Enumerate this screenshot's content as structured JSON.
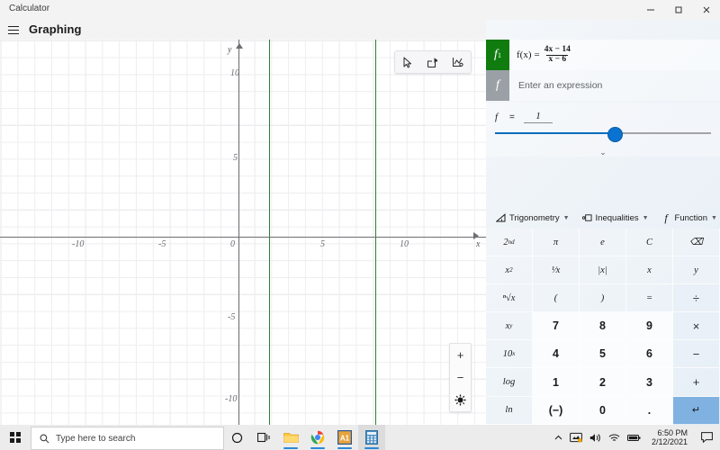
{
  "window": {
    "app_title": "Calculator",
    "minimize_icon": "minimize-icon",
    "maximize_icon": "maximize-icon",
    "close_icon": "close-icon"
  },
  "header": {
    "menu_icon": "hamburger-menu-icon",
    "mode_title": "Graphing"
  },
  "graph": {
    "x_axis_label": "x",
    "y_axis_label": "y",
    "x_ticks": [
      {
        "label": "-10",
        "value": -10
      },
      {
        "label": "-5",
        "value": -5
      },
      {
        "label": "0",
        "value": 0
      },
      {
        "label": "5",
        "value": 5
      },
      {
        "label": "10",
        "value": 10
      }
    ],
    "y_ticks": [
      {
        "label": "10",
        "value": 10
      },
      {
        "label": "5",
        "value": 5
      },
      {
        "label": "-5",
        "value": -5
      },
      {
        "label": "-10",
        "value": -10
      }
    ],
    "curve_color": "#2f7d32",
    "tools": [
      {
        "name": "pointer-tool",
        "icon": "cursor-arrow-icon"
      },
      {
        "name": "share-tool",
        "icon": "share-icon"
      },
      {
        "name": "graph-settings-tool",
        "icon": "graph-options-icon"
      }
    ],
    "zoom_controls": [
      {
        "name": "zoom-in-button",
        "label": "+"
      },
      {
        "name": "zoom-out-button",
        "label": "−"
      },
      {
        "name": "reset-view-button",
        "label": "reset-view-icon"
      }
    ]
  },
  "chart_data": {
    "type": "line",
    "title": "",
    "xlabel": "x",
    "ylabel": "y",
    "xlim": [
      -14,
      14.5
    ],
    "ylim": [
      -11,
      11.5
    ],
    "grid": true,
    "legend": "none",
    "series": [
      {
        "name": "f(x) = (4x - 14)/(x - 6)",
        "color": "#2f7d32",
        "expression": "f(x) = (4x − 14) / (x − 6)",
        "note": "Rendered as two near-vertical green lines (asymptote-like) at x = 3.5 and x = 8.1",
        "vertical_lines_x": [
          3.5,
          8.1
        ]
      }
    ]
  },
  "functions": [
    {
      "chip": "f",
      "chip_sub": "1",
      "state": "active",
      "lhs": "f(x)",
      "equals": "=",
      "numerator": "4x − 14",
      "denominator": "x − 6"
    },
    {
      "chip": "f",
      "chip_sub": "",
      "state": "idle",
      "placeholder": "Enter an expression"
    }
  ],
  "slider": {
    "variable": "f",
    "equals": "=",
    "value": "1",
    "expand_icon": "chevron-down-icon"
  },
  "categories": [
    {
      "label": "Trigonometry",
      "icon": "angle-icon",
      "chevron": "chevron-down-icon"
    },
    {
      "label": "Inequalities",
      "icon": "inequality-icon",
      "chevron": "chevron-down-icon"
    },
    {
      "label": "Function",
      "icon": "function-icon",
      "chevron": "chevron-down-icon"
    }
  ],
  "keypad": {
    "rows": [
      [
        {
          "label": "2",
          "sup": "nd",
          "name": "second-key",
          "kind": "fn"
        },
        {
          "label": "π",
          "name": "pi-key",
          "kind": "fn"
        },
        {
          "label": "e",
          "name": "euler-key",
          "kind": "fn"
        },
        {
          "label": "C",
          "name": "clear-key",
          "kind": "fn"
        },
        {
          "label": "⌫",
          "name": "backspace-key",
          "kind": "fn"
        }
      ],
      [
        {
          "label": "x",
          "sup": "2",
          "name": "square-key",
          "kind": "fn"
        },
        {
          "label": "¹⁄x",
          "name": "reciprocal-key",
          "kind": "fn"
        },
        {
          "label": "|x|",
          "name": "absolute-value-key",
          "kind": "fn"
        },
        {
          "label": "x",
          "name": "x-variable-key",
          "kind": "fn"
        },
        {
          "label": "y",
          "name": "y-variable-key",
          "kind": "fn"
        }
      ],
      [
        {
          "label": "ⁿ√x",
          "name": "nth-root-key",
          "kind": "fn"
        },
        {
          "label": "(",
          "name": "open-paren-key",
          "kind": "fn"
        },
        {
          "label": ")",
          "name": "close-paren-key",
          "kind": "fn"
        },
        {
          "label": "=",
          "name": "equals-key",
          "kind": "fn"
        },
        {
          "label": "÷",
          "name": "divide-key",
          "kind": "op"
        }
      ],
      [
        {
          "label": "x",
          "sup": "y",
          "name": "power-key",
          "kind": "fn"
        },
        {
          "label": "7",
          "name": "seven-key",
          "kind": "num"
        },
        {
          "label": "8",
          "name": "eight-key",
          "kind": "num"
        },
        {
          "label": "9",
          "name": "nine-key",
          "kind": "num"
        },
        {
          "label": "×",
          "name": "multiply-key",
          "kind": "op"
        }
      ],
      [
        {
          "label": "10",
          "sup": "x",
          "name": "ten-power-key",
          "kind": "fn"
        },
        {
          "label": "4",
          "name": "four-key",
          "kind": "num"
        },
        {
          "label": "5",
          "name": "five-key",
          "kind": "num"
        },
        {
          "label": "6",
          "name": "six-key",
          "kind": "num"
        },
        {
          "label": "−",
          "name": "subtract-key",
          "kind": "op"
        }
      ],
      [
        {
          "label": "log",
          "name": "log-key",
          "kind": "fn"
        },
        {
          "label": "1",
          "name": "one-key",
          "kind": "num"
        },
        {
          "label": "2",
          "name": "two-key",
          "kind": "num"
        },
        {
          "label": "3",
          "name": "three-key",
          "kind": "num"
        },
        {
          "label": "+",
          "name": "add-key",
          "kind": "op"
        }
      ],
      [
        {
          "label": "ln",
          "name": "ln-key",
          "kind": "fn"
        },
        {
          "label": "(−)",
          "name": "negate-key",
          "kind": "num"
        },
        {
          "label": "0",
          "name": "zero-key",
          "kind": "num"
        },
        {
          "label": ".",
          "name": "decimal-key",
          "kind": "num"
        },
        {
          "label": "↵",
          "name": "enter-key",
          "kind": "eq"
        }
      ]
    ]
  },
  "taskbar": {
    "start_icon": "windows-start-icon",
    "search_placeholder": "Type here to search",
    "search_icon": "search-icon",
    "items": [
      {
        "name": "cortana-icon",
        "glyph": "○"
      },
      {
        "name": "task-view-icon",
        "glyph": "⧉"
      },
      {
        "name": "file-explorer-icon",
        "glyph": "folder"
      },
      {
        "name": "chrome-icon",
        "glyph": "chrome"
      },
      {
        "name": "a1-app-icon",
        "glyph": "A1"
      },
      {
        "name": "calculator-icon",
        "glyph": "calculator"
      }
    ],
    "tray": {
      "chevron_icon": "show-hidden-icons-icon",
      "onedrive_icon": "onedrive-icon",
      "volume_icon": "volume-icon",
      "network_icon": "wifi-icon",
      "battery_icon": "battery-icon",
      "time": "6:50 PM",
      "date": "2/12/2021",
      "action_center_icon": "action-center-icon"
    }
  }
}
